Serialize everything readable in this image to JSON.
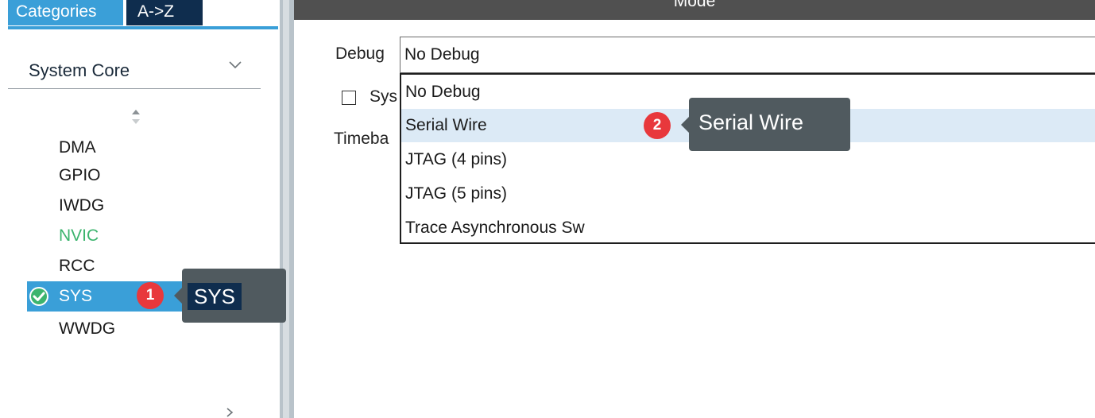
{
  "sidebar": {
    "tabs": {
      "categories": "Categories",
      "az": "A->Z"
    },
    "category": "System Core",
    "items": [
      "DMA",
      "GPIO",
      "IWDG",
      "NVIC",
      "RCC",
      "SYS",
      "WWDG"
    ],
    "selected_item": "SYS",
    "colors": {
      "accent": "#3a9fd8",
      "nvic": "#3cb46e"
    }
  },
  "main": {
    "mode_title": "Mode",
    "debug_label": "Debug",
    "debug_value": "No Debug",
    "sys_checkbox_label": "Sys",
    "timebase_label": "Timeba",
    "options": [
      "No Debug",
      "Serial Wire",
      "JTAG (4 pins)",
      "JTAG (5 pins)",
      "Trace Asynchronous Sw"
    ],
    "hovered_option": "Serial Wire"
  },
  "annotations": {
    "step1": {
      "number": "1",
      "label": "SYS"
    },
    "step2": {
      "number": "2",
      "label": "Serial Wire"
    }
  }
}
